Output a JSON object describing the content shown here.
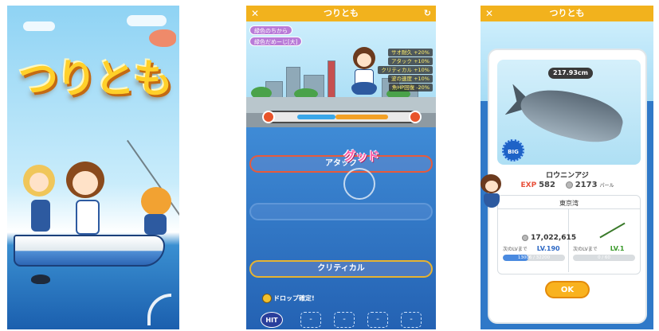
{
  "title_screen": {
    "logo": "つりとも"
  },
  "fishing_screen": {
    "header": {
      "title": "つりとも",
      "close": "✕",
      "refresh": "↻"
    },
    "skills": [
      "緑色のちから",
      "緑色だめーじ[大]"
    ],
    "buffs": [
      {
        "label": "サオ耐久",
        "value": "+20%"
      },
      {
        "label": "アタック",
        "value": "+10%"
      },
      {
        "label": "クリティカル",
        "value": "+10%"
      },
      {
        "label": "波の速度",
        "value": "+10%"
      },
      {
        "label": "魚HP回復",
        "value": "-20%"
      }
    ],
    "tension_progress": 0.55,
    "lanes": {
      "attack": "アタック",
      "middle": "",
      "critical": "クリティカル"
    },
    "feedback": "グッド",
    "drop_label": "ドロップ確定!",
    "hit_label": "HIT",
    "slots": [
      "-",
      "-",
      "-",
      "-"
    ]
  },
  "result_screen": {
    "header": {
      "title": "つりとも",
      "close": "✕"
    },
    "fish_size": "217.93cm",
    "big_badge": "BIG",
    "fish_name": "ロウニンアジ",
    "exp_label": "EXP",
    "exp_value": "582",
    "money_value": "2173",
    "money_unit": "パール",
    "place": "東京湾",
    "total_money": "17,022,615",
    "player": {
      "next_label": "次のLVまで",
      "level_label": "LV.",
      "level": "190",
      "progress_text": "13006 / 32200",
      "progress": 0.404
    },
    "rod": {
      "next_label": "次のLVまで",
      "level_label": "LV.",
      "level": "1",
      "progress_text": "0 / 60",
      "progress": 0.0
    },
    "ok_label": "OK"
  },
  "colors": {
    "header_orange": "#f2b21d",
    "sea_blue": "#2f79c8",
    "exp_red": "#e8503a",
    "level_blue": "#2d68c4",
    "level_green": "#3a9a2a",
    "ok_orange": "#f9b21e"
  }
}
